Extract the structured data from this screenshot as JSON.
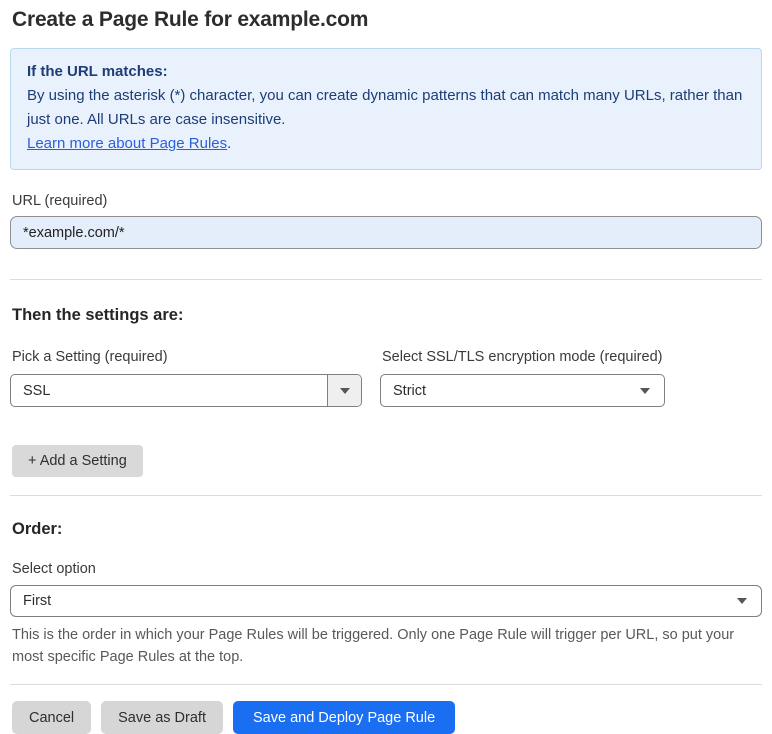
{
  "page": {
    "title": "Create a Page Rule for example.com"
  },
  "info_box": {
    "heading": "If the URL matches:",
    "body": "By using the asterisk (*) character, you can create dynamic patterns that can match many URLs, rather than just one. All URLs are case insensitive.",
    "link_label": "Learn more about Page Rules",
    "link_suffix": "."
  },
  "url_field": {
    "label": "URL (required)",
    "value": "*example.com/*"
  },
  "settings_section": {
    "heading": "Then the settings are:",
    "pick_setting": {
      "label": "Pick a Setting (required)",
      "value": "SSL"
    },
    "ssl_mode": {
      "label": "Select SSL/TLS encryption mode (required)",
      "value": "Strict"
    },
    "add_setting_label": "+ Add a Setting"
  },
  "order_section": {
    "heading": "Order:",
    "select_label": "Select option",
    "value": "First",
    "help_text": "This is the order in which your Page Rules will be triggered. Only one Page Rule will trigger per URL, so put your most specific Page Rules at the top."
  },
  "footer": {
    "cancel_label": "Cancel",
    "save_draft_label": "Save as Draft",
    "save_deploy_label": "Save and Deploy Page Rule"
  },
  "icons": {
    "select_caret": "caret-down-icon"
  },
  "colors": {
    "info_bg": "#e9f2fc",
    "info_border": "#bcd8f1",
    "info_text": "#1d3c78",
    "link_blue": "#2b5fd9",
    "url_input_bg": "#e4eefb",
    "gray_button_bg": "#d9d9d9",
    "primary_button_bg": "#1a6ef2",
    "divider": "#dcdcdc"
  }
}
